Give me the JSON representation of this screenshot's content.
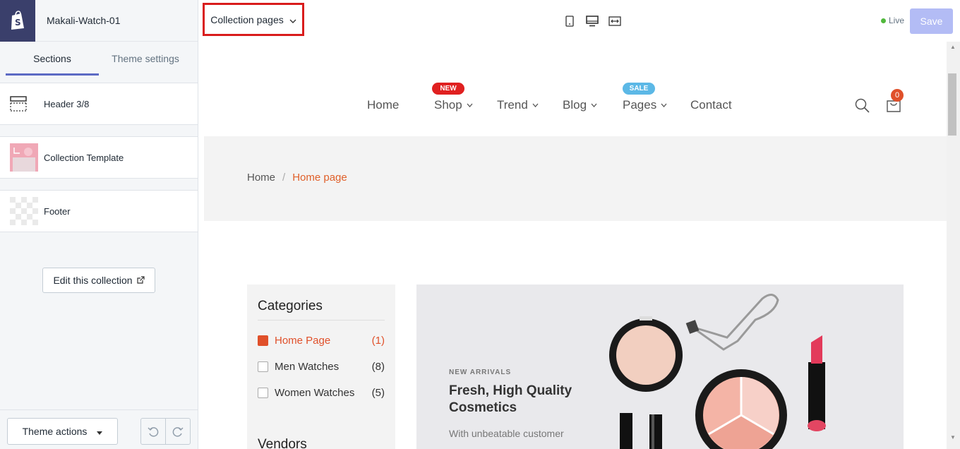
{
  "sidebar": {
    "store_name": "Makali-Watch-01",
    "tabs": [
      {
        "label": "Sections",
        "active": true
      },
      {
        "label": "Theme settings",
        "active": false
      }
    ],
    "sections": [
      {
        "label": "Header 3/8",
        "icon": "header-layout-icon"
      },
      {
        "label": "Collection Template",
        "icon": "collection-thumbnail"
      },
      {
        "label": "Footer",
        "icon": "footer-thumbnail"
      }
    ],
    "edit_collection_label": "Edit this collection",
    "theme_actions_label": "Theme actions"
  },
  "topbar": {
    "page_selector": "Collection pages",
    "live_label": "Live",
    "save_label": "Save",
    "colors": {
      "live": "#50b83c",
      "save_bg": "#b3bcf5",
      "highlight": "#d91c1c"
    }
  },
  "preview": {
    "nav": [
      {
        "label": "Home",
        "has_dropdown": false
      },
      {
        "label": "Shop",
        "has_dropdown": true,
        "badge": "NEW"
      },
      {
        "label": "Trend",
        "has_dropdown": true
      },
      {
        "label": "Blog",
        "has_dropdown": true
      },
      {
        "label": "Pages",
        "has_dropdown": true,
        "badge": "SALE"
      },
      {
        "label": "Contact",
        "has_dropdown": false
      }
    ],
    "cart_count": "0",
    "breadcrumb": {
      "home": "Home",
      "separator": "/",
      "current": "Home page"
    },
    "categories": {
      "title": "Categories",
      "items": [
        {
          "label": "Home Page",
          "count": "(1)",
          "checked": true
        },
        {
          "label": "Men Watches",
          "count": "(8)",
          "checked": false
        },
        {
          "label": "Women Watches",
          "count": "(5)",
          "checked": false
        }
      ],
      "vendors_title": "Vendors"
    },
    "banner": {
      "eyebrow": "NEW ARRIVALS",
      "title": "Fresh, High Quality Cosmetics",
      "subtitle": "With unbeatable customer"
    },
    "accent_color": "#e0502a"
  }
}
